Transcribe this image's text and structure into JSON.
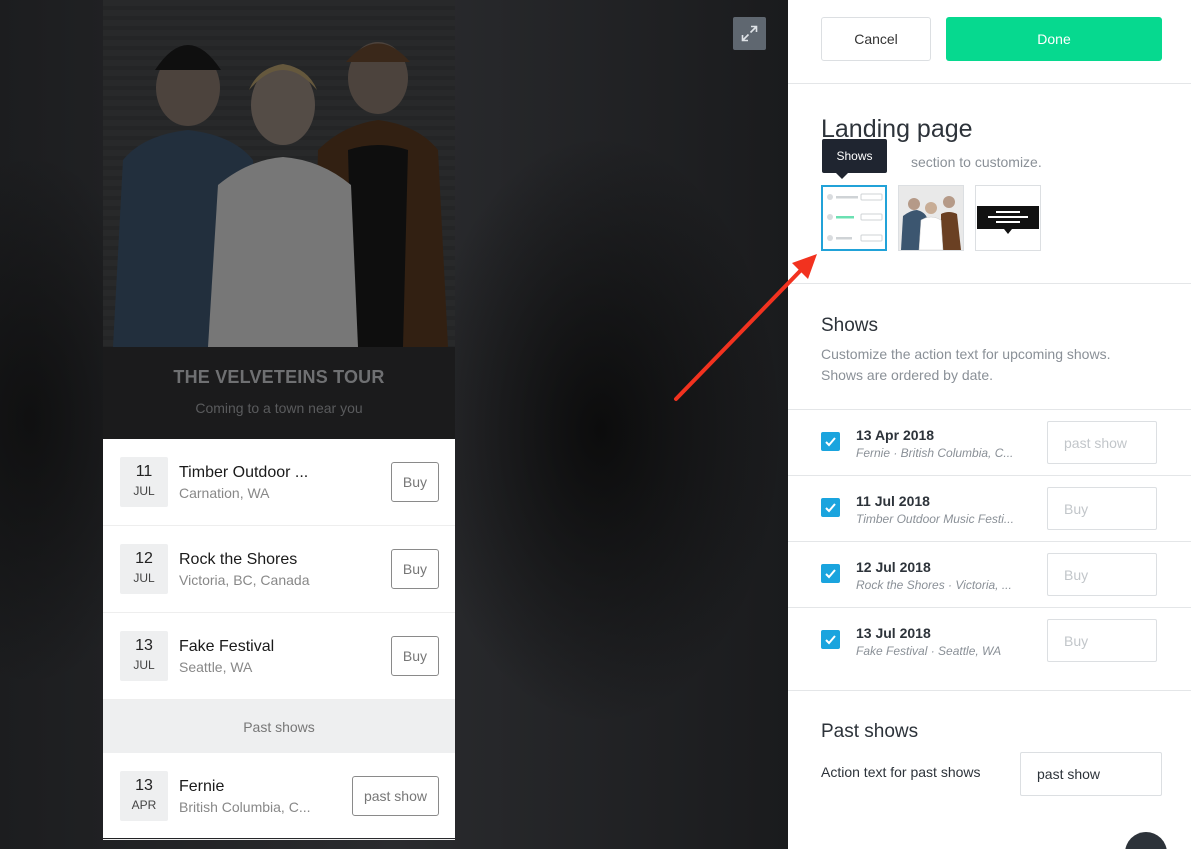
{
  "preview": {
    "hero_title": "THE VELVETEINS TOUR",
    "hero_subtitle": "Coming to a town near you",
    "shows": [
      {
        "day": "11",
        "month": "JUL",
        "name": "Timber Outdoor ...",
        "location": "Carnation, WA",
        "action": "Buy"
      },
      {
        "day": "12",
        "month": "JUL",
        "name": "Rock the Shores",
        "location": "Victoria, BC, Canada",
        "action": "Buy"
      },
      {
        "day": "13",
        "month": "JUL",
        "name": "Fake Festival",
        "location": "Seattle, WA",
        "action": "Buy"
      }
    ],
    "past_header": "Past shows",
    "past_shows": [
      {
        "day": "13",
        "month": "APR",
        "name": "Fernie",
        "location": "British Columbia, C...",
        "action": "past show"
      }
    ]
  },
  "panel": {
    "cancel_label": "Cancel",
    "done_label": "Done",
    "landing_title": "Landing page",
    "landing_subtitle": "section to customize.",
    "tooltip": "Shows",
    "shows_title": "Shows",
    "shows_desc_1": "Customize the action text for upcoming shows.",
    "shows_desc_2": "Shows are ordered by date.",
    "show_rows": [
      {
        "date": "13 Apr 2018",
        "venue": "Fernie · British Columbia, C...",
        "placeholder": "past show",
        "checked": true
      },
      {
        "date": "11 Jul 2018",
        "venue": "Timber Outdoor Music Festi...",
        "placeholder": "Buy",
        "checked": true
      },
      {
        "date": "12 Jul 2018",
        "venue": "Rock the Shores · Victoria, ...",
        "placeholder": "Buy",
        "checked": true
      },
      {
        "date": "13 Jul 2018",
        "venue": "Fake Festival · Seattle, WA",
        "placeholder": "Buy",
        "checked": true
      }
    ],
    "past_title": "Past shows",
    "past_label": "Action text for past shows",
    "past_value": "past show"
  },
  "colors": {
    "accent_green": "#06d98f",
    "checkbox_blue": "#1aa4de",
    "annotation_red": "#f2321f"
  },
  "icons": [
    "expand-icon",
    "checkmark-icon"
  ]
}
